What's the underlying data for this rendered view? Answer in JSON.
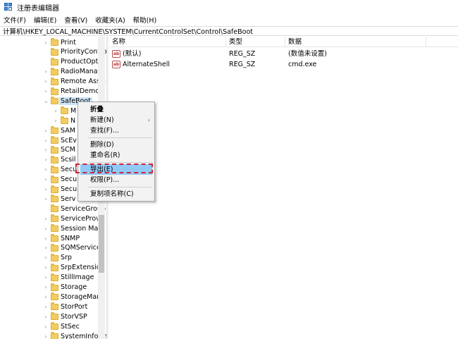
{
  "window": {
    "title": "注册表编辑器"
  },
  "menu": [
    "文件(F)",
    "编辑(E)",
    "查看(V)",
    "收藏夹(A)",
    "帮助(H)"
  ],
  "address": "计算机\\HKEY_LOCAL_MACHINE\\SYSTEM\\CurrentControlSet\\Control\\SafeBoot",
  "tree": {
    "items": [
      {
        "label": "Print",
        "arrow": "›",
        "level": 0
      },
      {
        "label": "PriorityContro",
        "arrow": "",
        "level": 0
      },
      {
        "label": "ProductOptio",
        "arrow": "",
        "level": 0
      },
      {
        "label": "RadioManag",
        "arrow": "›",
        "level": 0
      },
      {
        "label": "Remote Assis",
        "arrow": "›",
        "level": 0
      },
      {
        "label": "RetailDemo",
        "arrow": "›",
        "level": 0
      },
      {
        "label": "SafeBoot",
        "arrow": "⌄",
        "level": 0,
        "selected": true
      },
      {
        "label": "M",
        "arrow": "›",
        "level": 1
      },
      {
        "label": "N",
        "arrow": "›",
        "level": 1
      },
      {
        "label": "SAM",
        "arrow": "›",
        "level": 0
      },
      {
        "label": "ScEv",
        "arrow": "›",
        "level": 0
      },
      {
        "label": "SCM",
        "arrow": "›",
        "level": 0
      },
      {
        "label": "Scsil",
        "arrow": "›",
        "level": 0
      },
      {
        "label": "Secu",
        "arrow": "›",
        "level": 0
      },
      {
        "label": "Secu",
        "arrow": "›",
        "level": 0
      },
      {
        "label": "Secu",
        "arrow": "›",
        "level": 0
      },
      {
        "label": "Serv",
        "arrow": "›",
        "level": 0
      },
      {
        "label": "ServiceGroup",
        "arrow": "",
        "level": 0
      },
      {
        "label": "ServiceProvic",
        "arrow": "›",
        "level": 0
      },
      {
        "label": "Session Man",
        "arrow": "›",
        "level": 0
      },
      {
        "label": "SNMP",
        "arrow": "›",
        "level": 0
      },
      {
        "label": "SQMServiceL",
        "arrow": "›",
        "level": 0
      },
      {
        "label": "Srp",
        "arrow": "›",
        "level": 0
      },
      {
        "label": "SrpExtension",
        "arrow": "›",
        "level": 0
      },
      {
        "label": "StillImage",
        "arrow": "›",
        "level": 0
      },
      {
        "label": "Storage",
        "arrow": "›",
        "level": 0
      },
      {
        "label": "StorageMana",
        "arrow": "›",
        "level": 0
      },
      {
        "label": "StorPort",
        "arrow": "›",
        "level": 0
      },
      {
        "label": "StorVSP",
        "arrow": "›",
        "level": 0
      },
      {
        "label": "StSec",
        "arrow": "›",
        "level": 0
      },
      {
        "label": "SystemInform",
        "arrow": "›",
        "level": 0
      }
    ]
  },
  "list": {
    "columns": [
      "名称",
      "类型",
      "数据"
    ],
    "rows": [
      {
        "icon": "ab",
        "name": "(默认)",
        "type": "REG_SZ",
        "data": "(数值未设置)"
      },
      {
        "icon": "ab",
        "name": "AlternateShell",
        "type": "REG_SZ",
        "data": "cmd.exe"
      }
    ]
  },
  "context_menu": {
    "items": [
      {
        "label": "折叠",
        "bold": true
      },
      {
        "label": "新建(N)",
        "submenu": "›"
      },
      {
        "label": "查找(F)..."
      },
      {
        "separator": true
      },
      {
        "label": "删除(D)"
      },
      {
        "label": "重命名(R)"
      },
      {
        "separator": true
      },
      {
        "label": "导出(E)",
        "highlight": true
      },
      {
        "label": "权限(P)..."
      },
      {
        "separator": true
      },
      {
        "label": "复制项名称(C)"
      }
    ]
  },
  "colors": {
    "highlight": "#91c9f7",
    "annotation_box": "#d0243a",
    "selection": "#cce4f7"
  }
}
